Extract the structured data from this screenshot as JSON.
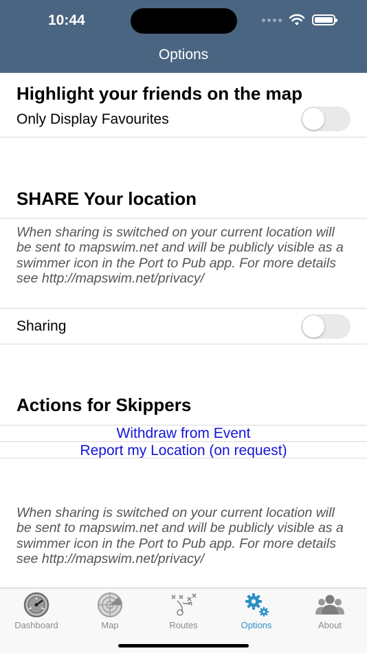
{
  "status_bar": {
    "time": "10:44"
  },
  "nav": {
    "title": "Options"
  },
  "friends": {
    "heading": "Highlight your friends on the map",
    "favourites_label": "Only Display Favourites",
    "favourites_on": false
  },
  "share": {
    "heading": "SHARE Your location",
    "description": "When sharing is switched on your current location will be sent to mapswim.net and will be publicly visible as a swimmer icon in the Port to Pub app.  For more details see http://mapswim.net/privacy/",
    "sharing_label": "Sharing",
    "sharing_on": false
  },
  "skippers": {
    "heading": "Actions for Skippers",
    "withdraw_label": "Withdraw from Event",
    "report_label": "Report my Location (on request)",
    "footer_description": "When sharing is switched on your current location will be sent to mapswim.net and will be publicly visible as a swimmer icon in the Port to Pub app.  For more details see http://mapswim.net/privacy/"
  },
  "tabs": [
    {
      "label": "Dashboard",
      "icon": "dashboard-icon",
      "active": false
    },
    {
      "label": "Map",
      "icon": "map-icon",
      "active": false
    },
    {
      "label": "Routes",
      "icon": "routes-icon",
      "active": false
    },
    {
      "label": "Options",
      "icon": "gear-icon",
      "active": true
    },
    {
      "label": "About",
      "icon": "people-icon",
      "active": false
    }
  ],
  "colors": {
    "nav_bar": "#4a6582",
    "link": "#1414d8",
    "active_tab": "#2b8fc5"
  }
}
